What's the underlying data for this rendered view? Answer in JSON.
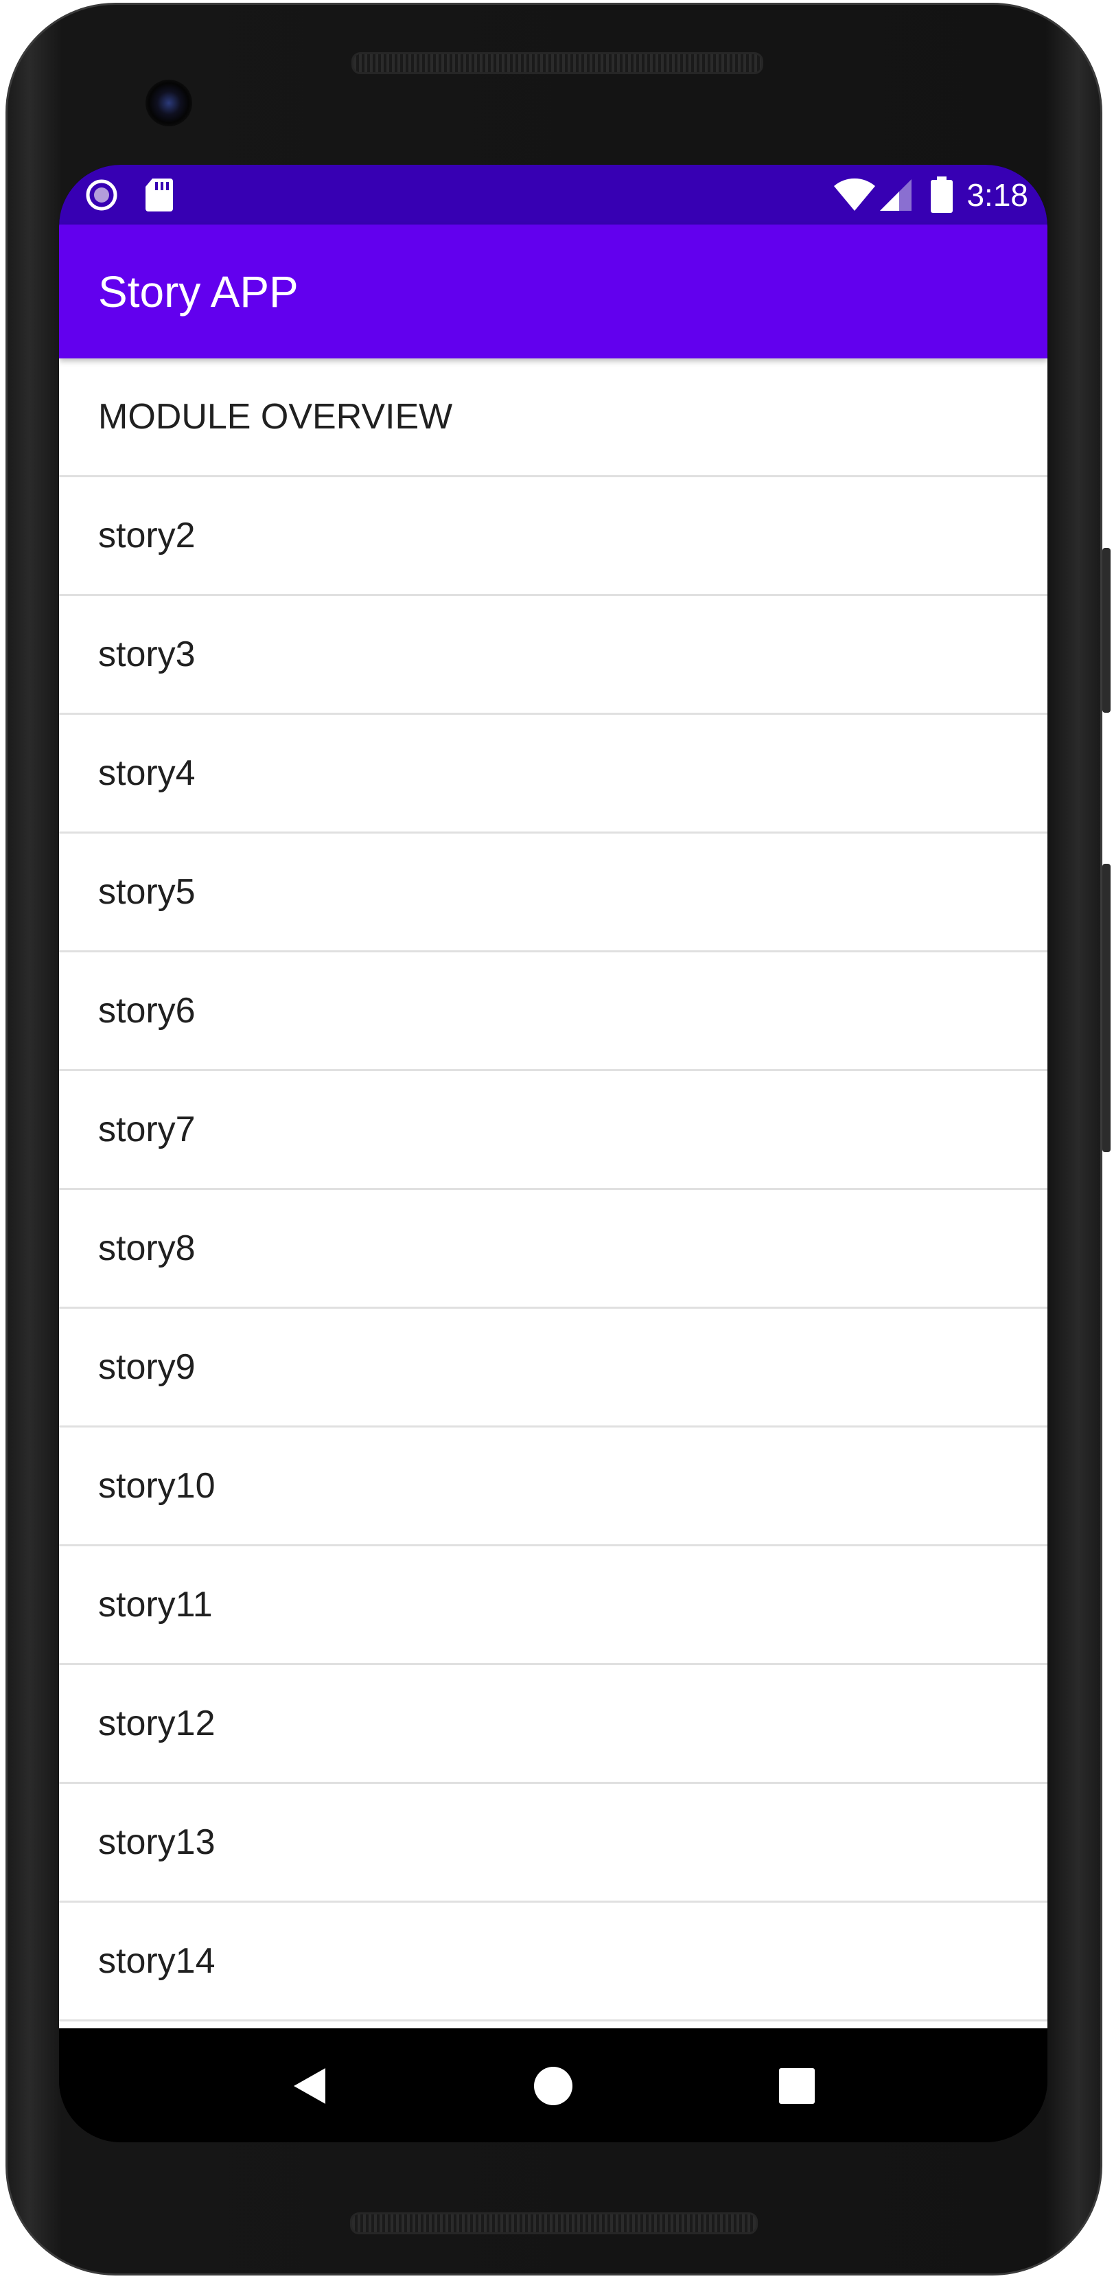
{
  "status_bar": {
    "time": "3:18",
    "icons": [
      "notification-circle-icon",
      "sd-card-icon",
      "wifi-icon",
      "cell-signal-icon",
      "battery-icon"
    ]
  },
  "app_bar": {
    "title": "Story APP"
  },
  "list": {
    "items": [
      {
        "label": "MODULE OVERVIEW"
      },
      {
        "label": "story2"
      },
      {
        "label": "story3"
      },
      {
        "label": "story4"
      },
      {
        "label": "story5"
      },
      {
        "label": "story6"
      },
      {
        "label": "story7"
      },
      {
        "label": "story8"
      },
      {
        "label": "story9"
      },
      {
        "label": "story10"
      },
      {
        "label": "story11"
      },
      {
        "label": "story12"
      },
      {
        "label": "story13"
      },
      {
        "label": "story14"
      },
      {
        "label": ""
      }
    ]
  },
  "nav_bar": {
    "buttons": [
      "back-icon",
      "home-icon",
      "recents-icon"
    ]
  },
  "colors": {
    "status_bar": "#3700b3",
    "app_bar": "#6200ee",
    "list_background": "#ffffff",
    "divider": "#e0e0e0",
    "text": "#202020"
  }
}
